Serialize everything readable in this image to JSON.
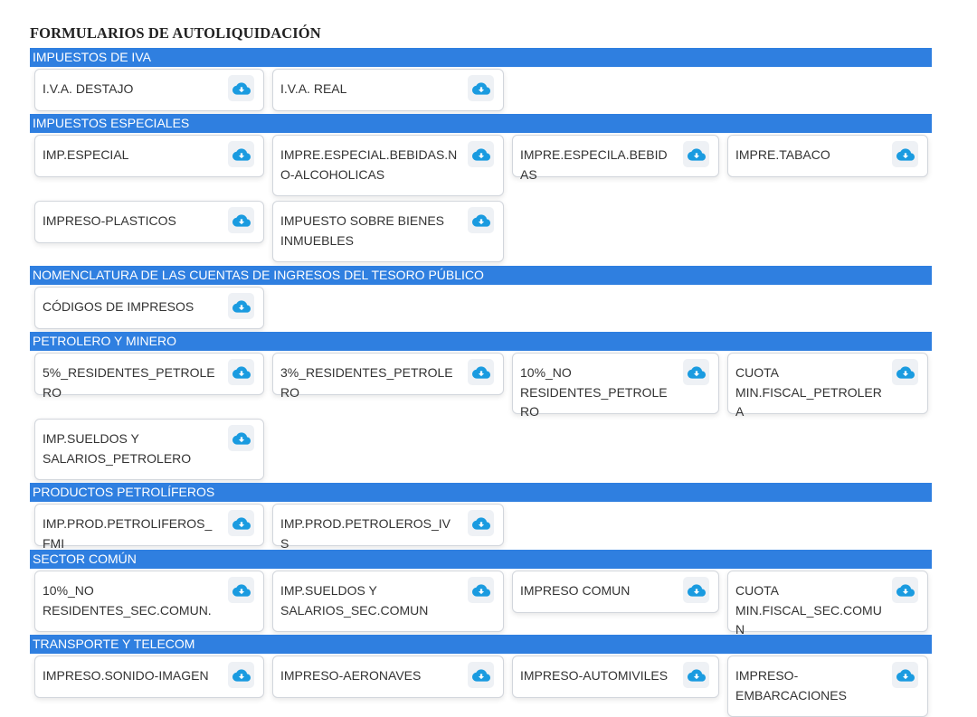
{
  "page_title": "FORMULARIOS DE AUTOLIQUIDACIÓN",
  "icon_color": "#1a9be0",
  "header_color": "#2f7fe0",
  "download_icon": "cloud-download-icon",
  "sections": [
    {
      "title": "IMPUESTOS DE IVA",
      "items": [
        "I.V.A. DESTAJO",
        "I.V.A. REAL"
      ]
    },
    {
      "title": "IMPUESTOS ESPECIALES",
      "items": [
        "IMP.ESPECIAL",
        "IMPRE.ESPECIAL.BEBIDAS.NO-ALCOHOLICAS",
        "IMPRE.ESPECILA.BEBIDAS",
        "IMPRE.TABACO",
        "IMPRESO-PLASTICOS",
        "IMPUESTO SOBRE BIENES INMUEBLES"
      ]
    },
    {
      "title": "NOMENCLATURA DE LAS CUENTAS DE INGRESOS DEL TESORO PÚBLICO",
      "items": [
        "CÓDIGOS DE IMPRESOS"
      ]
    },
    {
      "title": "PETROLERO Y MINERO",
      "items": [
        "5%_RESIDENTES_PETROLERO",
        "3%_RESIDENTES_PETROLERO",
        "10%_NO RESIDENTES_PETROLERO",
        "CUOTA MIN.FISCAL_PETROLERA",
        "IMP.SUELDOS Y SALARIOS_PETROLERO"
      ]
    },
    {
      "title": "PRODUCTOS PETROLÍFEROS",
      "items": [
        "IMP.PROD.PETROLIFEROS_FMI",
        "IMP.PROD.PETROLEROS_IVS"
      ]
    },
    {
      "title": "SECTOR COMÚN",
      "items": [
        "10%_NO RESIDENTES_SEC.COMUN.",
        "IMP.SUELDOS Y SALARIOS_SEC.COMUN",
        "IMPRESO COMUN",
        "CUOTA MIN.FISCAL_SEC.COMUN"
      ]
    },
    {
      "title": "TRANSPORTE Y TELECOM",
      "items": [
        "IMPRESO.SONIDO-IMAGEN",
        "IMPRESO-AERONAVES",
        "IMPRESO-AUTOMIVILES",
        "IMPRESO-EMBARCACIONES"
      ]
    }
  ]
}
